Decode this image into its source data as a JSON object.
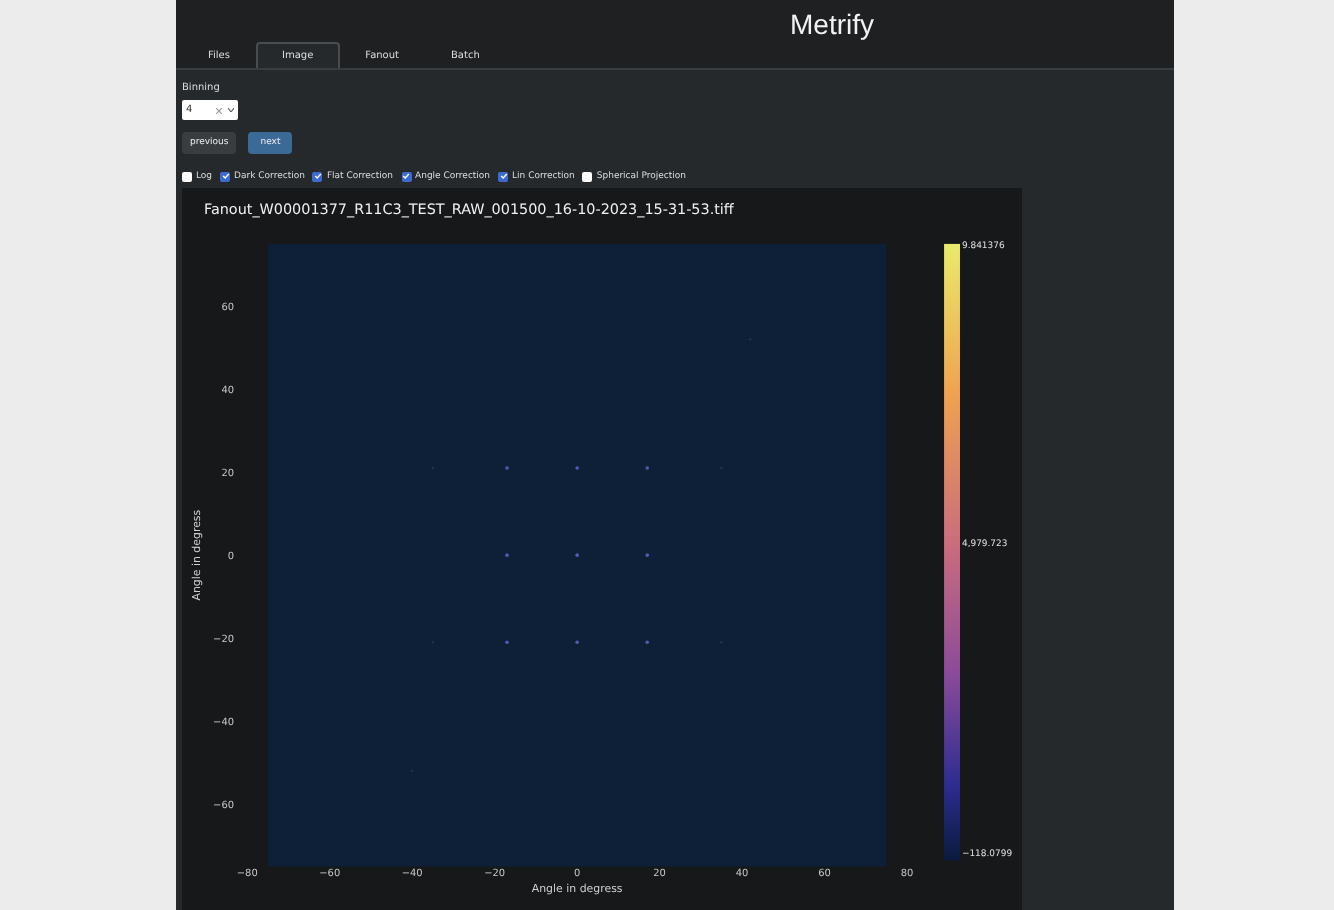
{
  "app": {
    "title": "Metrify"
  },
  "tabs": [
    {
      "label": "Files",
      "selected": false
    },
    {
      "label": "Image",
      "selected": true
    },
    {
      "label": "Fanout",
      "selected": false
    },
    {
      "label": "Batch",
      "selected": false
    }
  ],
  "binning": {
    "label": "Binning",
    "value": "4"
  },
  "buttons": [
    {
      "label": "previous",
      "kind": "secondary"
    },
    {
      "label": "next",
      "kind": "primary"
    }
  ],
  "options": [
    {
      "label": "Log",
      "checked": false
    },
    {
      "label": "Dark Correction",
      "checked": true
    },
    {
      "label": "Flat Correction",
      "checked": true
    },
    {
      "label": "Angle Correction",
      "checked": true
    },
    {
      "label": "Lin Correction",
      "checked": true
    },
    {
      "label": "Spherical Projection",
      "checked": false
    }
  ],
  "plot": {
    "title": "Fanout_W00001377_R11C3_TEST_RAW_001500_16-10-2023_15-31-53.tiff",
    "xlabel": "Angle in degress",
    "ylabel": "Angle in degress",
    "xticks": [
      "−80",
      "−60",
      "−40",
      "−20",
      "0",
      "20",
      "40",
      "60",
      "80"
    ],
    "yticks": [
      "60",
      "40",
      "20",
      "0",
      "−20",
      "−40",
      "−60"
    ],
    "colorbar_labels": [
      "9.841376",
      "4,979.723",
      "−118.0799"
    ]
  }
}
